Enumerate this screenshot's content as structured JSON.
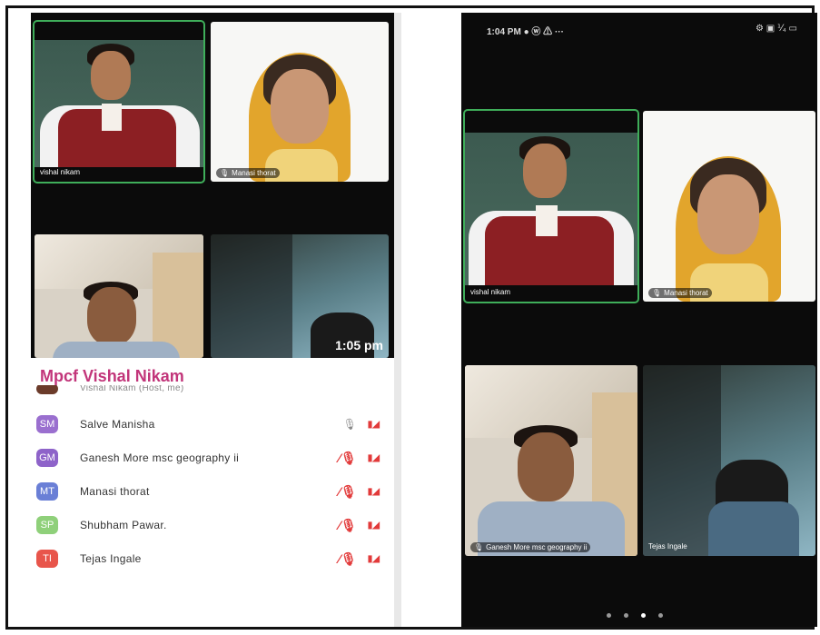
{
  "left_panel": {
    "tiles": [
      {
        "name": "vishal nikam",
        "muted": false
      },
      {
        "name": "Manasi thorat",
        "muted": true
      },
      {
        "name": "",
        "muted": false
      },
      {
        "name": "",
        "muted": false
      }
    ],
    "timestamp": "1:05 pm",
    "participant_list": {
      "title": "Mpcf Vishal Nikam",
      "partial_row": "Vishal Nikam (Host, me)",
      "rows": [
        {
          "initials": "SM",
          "name": "Salve Manisha",
          "color": "#9a6fcf",
          "mic": "on"
        },
        {
          "initials": "GM",
          "name": "Ganesh More msc geography  ii",
          "color": "#8e63c9",
          "mic": "off"
        },
        {
          "initials": "MT",
          "name": "Manasi thorat",
          "color": "#6a7fd6",
          "mic": "off"
        },
        {
          "initials": "SP",
          "name": "Shubham Pawar.",
          "color": "#8fd07a",
          "mic": "off"
        },
        {
          "initials": "TI",
          "name": "Tejas Ingale",
          "color": "#e8554b",
          "mic": "off"
        }
      ]
    }
  },
  "phone": {
    "status_time": "1:04 PM",
    "status_icons_left": "● ⓦ ⚠ ···",
    "status_icons_right": "⚙ ▣ ⅟₄ ▭",
    "tiles": [
      {
        "name": "vishal nikam"
      },
      {
        "name": "Manasi thorat"
      },
      {
        "name": "Ganesh More msc geography  ii"
      },
      {
        "name": "Tejas Ingale"
      }
    ],
    "page_dots": 4,
    "active_dot": 3
  }
}
